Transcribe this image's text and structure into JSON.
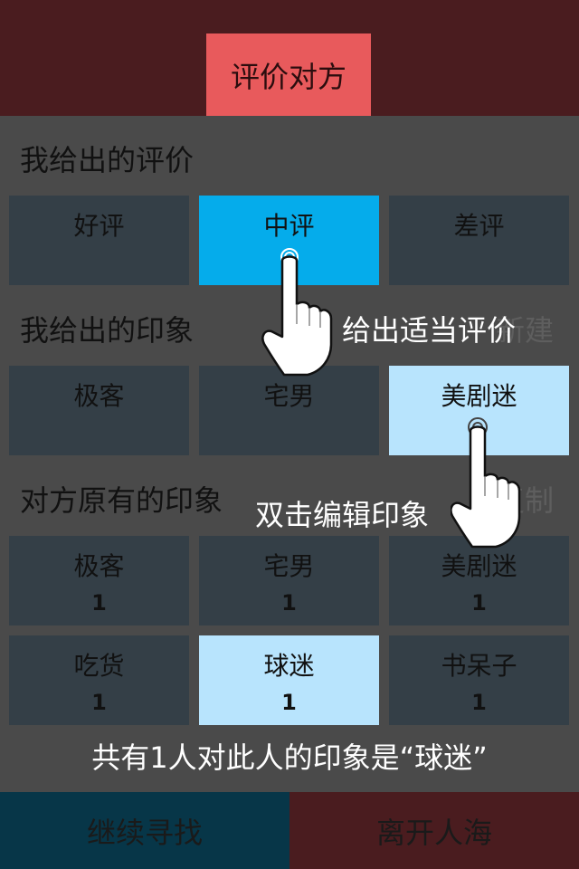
{
  "header": {
    "title": "评价对方"
  },
  "my_rating": {
    "label": "我给出的评价",
    "options": [
      "好评",
      "中评",
      "差评"
    ],
    "selected": "中评"
  },
  "my_impressions": {
    "label": "我给出的印象",
    "faded_action": "新建",
    "tags": [
      "极客",
      "宅男",
      "美剧迷"
    ],
    "highlighted": "美剧迷"
  },
  "their_impressions": {
    "label": "对方原有的印象",
    "faded_action": "复制",
    "tags": [
      {
        "name": "极客",
        "count": "1"
      },
      {
        "name": "宅男",
        "count": "1"
      },
      {
        "name": "美剧迷",
        "count": "1"
      },
      {
        "name": "吃货",
        "count": "1"
      },
      {
        "name": "球迷",
        "count": "1"
      },
      {
        "name": "书呆子",
        "count": "1"
      }
    ],
    "highlighted": "球迷"
  },
  "tutorial": {
    "hint_rate": "给出适当评价",
    "hint_edit": "双击编辑印象",
    "hint_summary": "共有1人对此人的印象是“球迷”",
    "icons": [
      "tap-hand-icon",
      "double-tap-hand-icon"
    ]
  },
  "footer": {
    "continue_label": "继续寻找",
    "leave_label": "离开人海"
  },
  "colors": {
    "header_bg": "#4a1c1f",
    "title_tab": "#e85a5c",
    "panel_bg": "#4a4a4a",
    "tile": "#343f47",
    "selected": "#05aceb",
    "highlight": "#b8e4fd",
    "continue_bg": "#073648"
  }
}
